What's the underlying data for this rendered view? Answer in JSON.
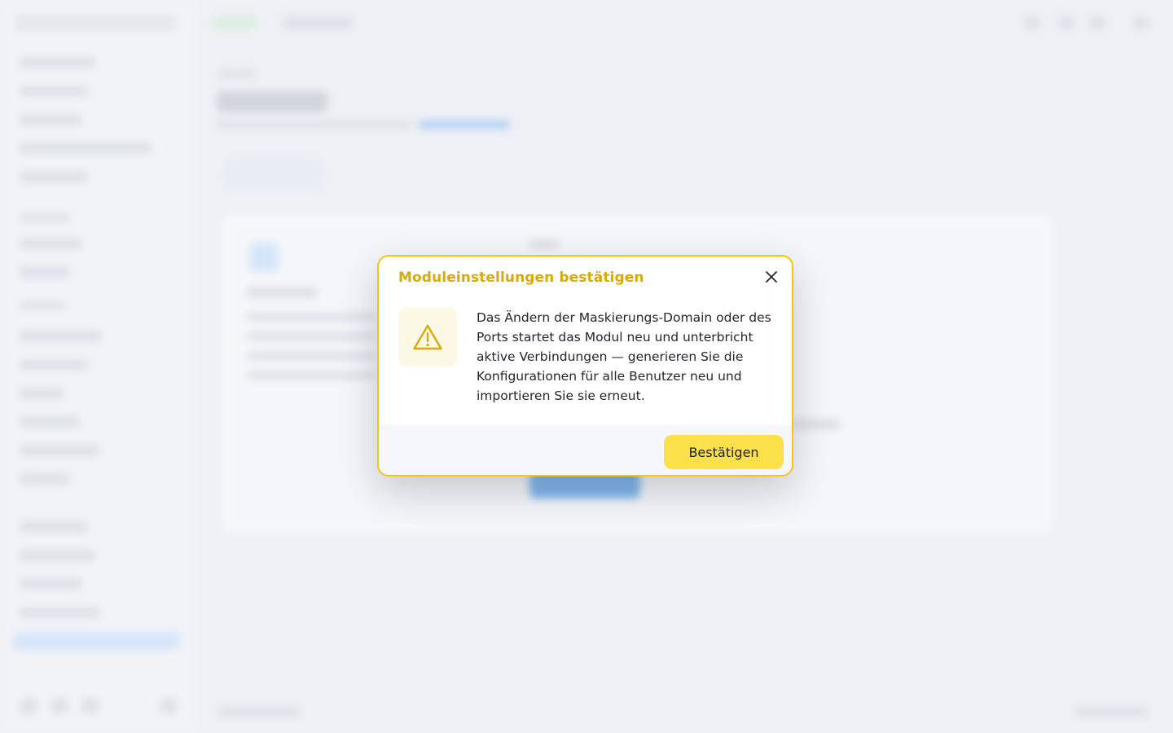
{
  "modal": {
    "title": "Moduleinstellungen bestätigen",
    "message": "Das Ändern der Maskierungs-Domain oder des Ports startet das Modul neu und unterbricht aktive Verbindungen — generieren Sie die Konfigurationen für alle Benutzer neu und importieren Sie sie erneut.",
    "confirm_label": "Bestätigen",
    "accent_color": "#f0c419",
    "title_color": "#d9a90b",
    "button_color": "#fbe04a",
    "icons": {
      "warning": "warning-triangle-icon",
      "close": "close-icon"
    }
  },
  "background": {
    "blurred": true
  }
}
